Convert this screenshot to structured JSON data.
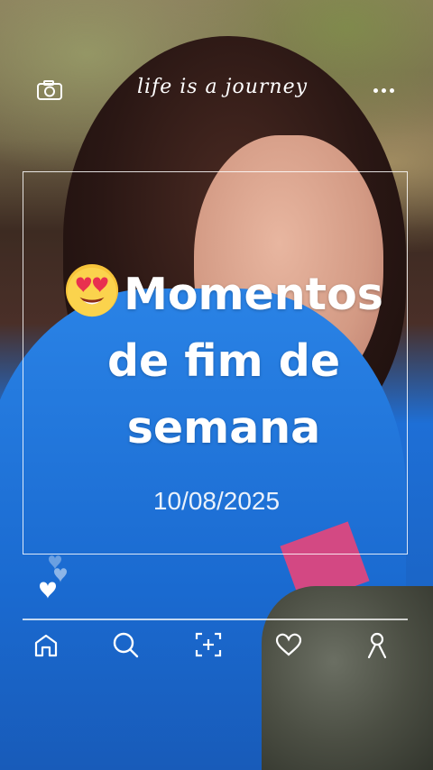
{
  "header": {
    "brand": "life is a journey",
    "camera_icon": "camera-icon",
    "more_icon": "more-horizontal-icon"
  },
  "card": {
    "title_emoji": "smiling-face-with-heart-eyes",
    "title": "Momentos de fim de semana",
    "date": "10/08/2025"
  },
  "reactions": {
    "icon": "hearts-icon"
  },
  "bottom_nav": {
    "items": [
      {
        "icon": "home-icon"
      },
      {
        "icon": "search-icon"
      },
      {
        "icon": "add-scan-icon"
      },
      {
        "icon": "heart-icon"
      },
      {
        "icon": "profile-icon"
      }
    ]
  },
  "colors": {
    "overlay_text": "#ffffff",
    "top_blue": "#1a6ad0"
  }
}
